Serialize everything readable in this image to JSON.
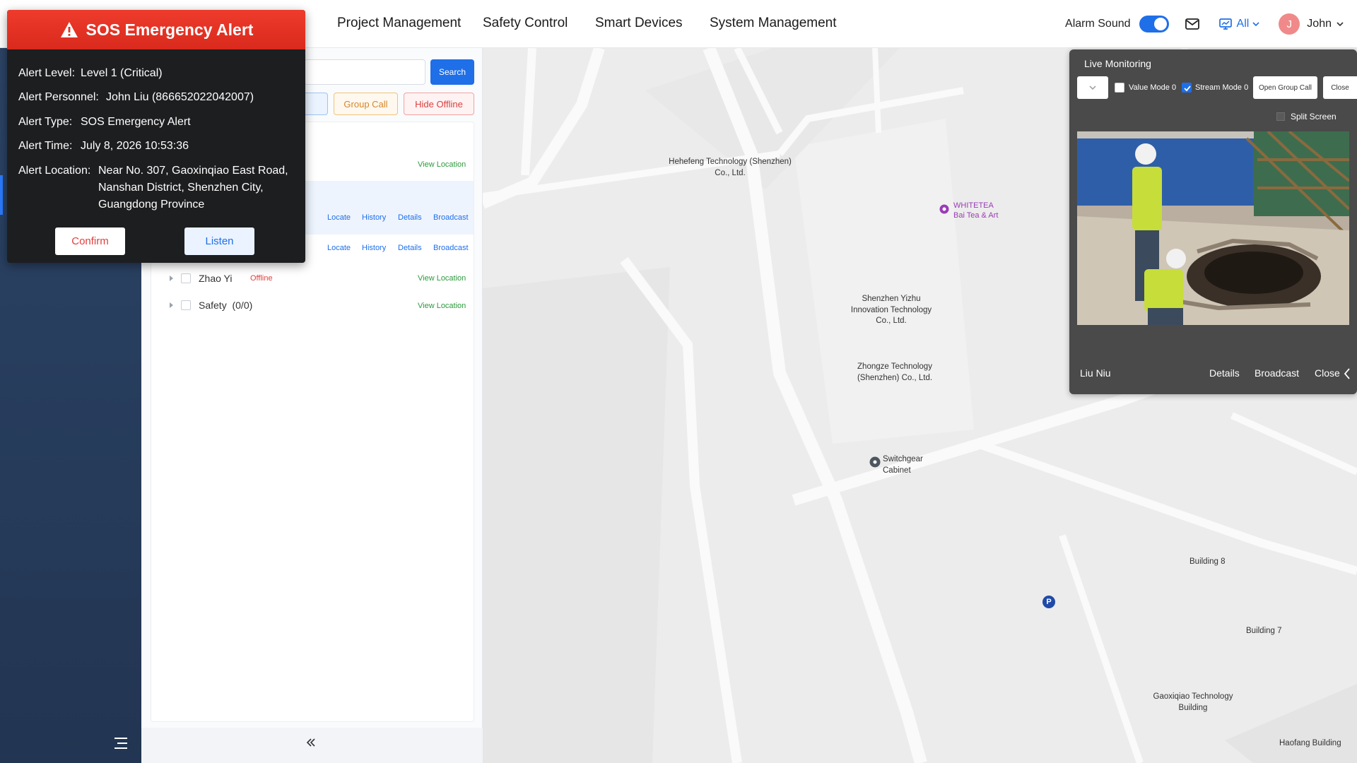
{
  "nav": {
    "items": [
      "Project Management",
      "Safety Control",
      "Smart Devices",
      "System Management"
    ],
    "alarm_sound_label": "Alarm Sound",
    "alarm_sound_on": true,
    "filter_label": "All",
    "user_initial": "J",
    "user_name": "John"
  },
  "panel": {
    "search_label": "Search",
    "group_call_label": "Group Call",
    "hide_offline_label": "Hide Offline",
    "view_location": "View Location",
    "actions": [
      "Locate",
      "History",
      "Details",
      "Broadcast"
    ],
    "rows": [
      {
        "name": "Zhao Yi",
        "status": "Offline"
      },
      {
        "name": "Safety",
        "count": "(0/0)"
      }
    ]
  },
  "live": {
    "title": "Live Monitoring",
    "value_mode": "Value Mode 0",
    "stream_mode": "Stream Mode 0",
    "open_group_call": "Open Group Call",
    "close": "Close",
    "split_screen": "Split Screen",
    "person": "Liu Niu",
    "actions": [
      "Details",
      "Broadcast",
      "Close"
    ]
  },
  "sos": {
    "title": "SOS Emergency Alert",
    "fields": [
      {
        "label": "Alert Level:",
        "value": "Level 1 (Critical)"
      },
      {
        "label": "Alert Personnel:",
        "value": "John Liu (866652022042007)"
      },
      {
        "label": "Alert Type:",
        "value": "SOS Emergency Alert"
      },
      {
        "label": "Alert Time:",
        "value": "July 8, 2026 10:53:36"
      },
      {
        "label": "Alert Location:",
        "value": "Near No. 307, Gaoxinqiao East Road, Nanshan District, Shenzhen City, Guangdong Province"
      }
    ],
    "confirm": "Confirm",
    "listen": "Listen"
  },
  "map": {
    "pois": [
      "Hehefeng Technology (Shenzhen) Co., Ltd.",
      "Shenzhen Yizhu Innovation Technology Co., Ltd.",
      "Zhongze Technology (Shenzhen) Co., Ltd.",
      "Switchgear Cabinet",
      "Building 8",
      "Building 7",
      "Gaoxiqiao Technology Building",
      "Haofang Building"
    ],
    "whitetea_name": "WHITETEA",
    "whitetea_sub": "Bai Tea & Art",
    "parking_label": "P"
  }
}
